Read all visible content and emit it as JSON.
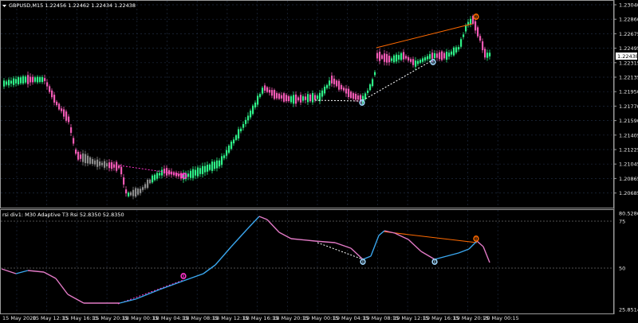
{
  "main": {
    "header": "GBPUSD,M15  1.22456 1.22462 1.22434 1.22438",
    "symbol_menu_icon": "triangle-down-icon",
    "price_labels": [
      "1.23040",
      "1.22860",
      "1.22675",
      "1.22495",
      "1.22315",
      "1.22135",
      "1.21950",
      "1.21770",
      "1.21590",
      "1.21405",
      "1.21225",
      "1.21045",
      "1.20865",
      "1.20685"
    ],
    "current_price": "1.22438"
  },
  "sub": {
    "header": "rsi div1: M30 Adaptive T3 Rsi 52.8350 52.8350",
    "levels": [
      "80.5286",
      "75",
      "50",
      "25.8514"
    ]
  },
  "time_labels": [
    "15 May 2020",
    "15 May 12:15",
    "15 May 16:15",
    "15 May 20:15",
    "18 May 00:15",
    "18 May 04:15",
    "18 May 08:15",
    "18 May 12:15",
    "18 May 16:15",
    "18 May 20:15",
    "19 May 00:15",
    "19 May 04:15",
    "19 May 08:15",
    "19 May 12:15",
    "19 May 16:15",
    "19 May 20:15",
    "20 May 00:15"
  ],
  "colors": {
    "up": "#2eef87",
    "down": "#f05ab4",
    "neutral": "#8c8c8c",
    "rsi_up": "#3aa6ee",
    "rsi_down": "#e27ac6",
    "bull_div": "#a0d8ff",
    "bear_div": "#ff6a00",
    "magenta_div": "#ff33cc",
    "grid": "#1f2a3f"
  },
  "markers": {
    "bull": "bull-divergence-icon",
    "bear": "bear-divergence-icon",
    "hidden": "hidden-divergence-icon"
  }
}
